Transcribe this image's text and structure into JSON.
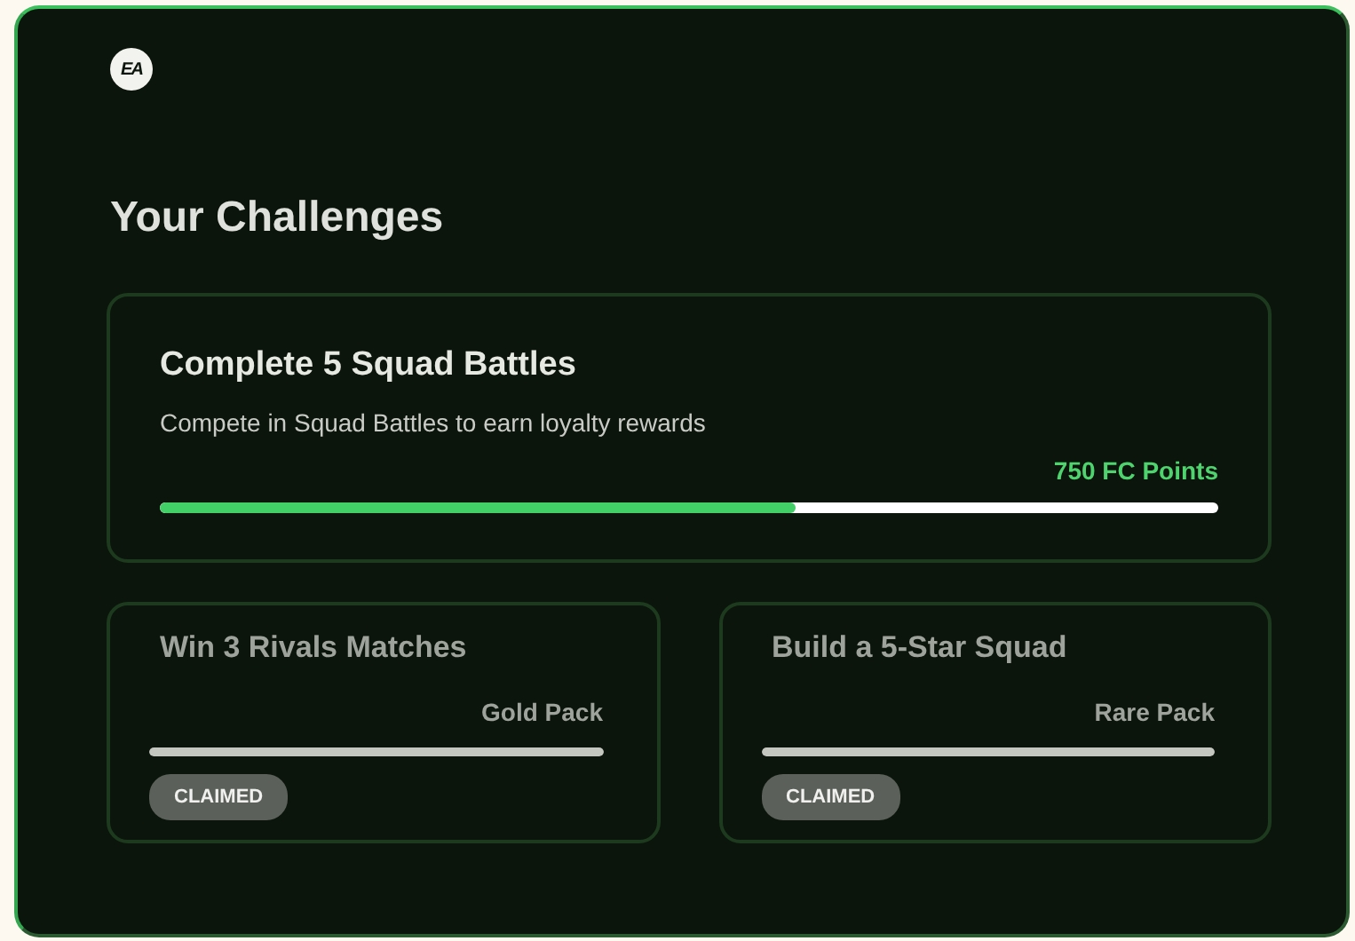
{
  "logo": {
    "text": "EA"
  },
  "heading": "Your Challenges",
  "challenges": [
    {
      "kind": "featured",
      "title": "Complete 5 Squad Battles",
      "description": "Compete in Squad Battles to earn loyalty rewards",
      "reward": "750 FC Points",
      "level": 0.6,
      "claimed": false
    },
    {
      "kind": "compact",
      "title": "Win 3 Rivals Matches",
      "reward": "Gold Pack",
      "level": 1,
      "claimed": true,
      "badge": "CLAIMED"
    },
    {
      "kind": "compact",
      "title": "Build a 5-Star Squad",
      "reward": "Rare Pack",
      "level": 1,
      "claimed": true,
      "badge": "CLAIMED"
    }
  ]
}
